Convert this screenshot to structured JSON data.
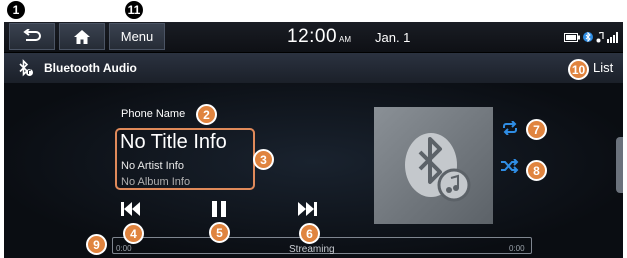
{
  "statusbar": {
    "menu_label": "Menu",
    "time": "12:00",
    "ampm": "AM",
    "date": "Jan. 1",
    "icons": [
      "battery-icon",
      "bluetooth-status-icon",
      "music-status-icon",
      "signal-icon"
    ]
  },
  "titlebar": {
    "title": "Bluetooth Audio",
    "list_label": "List"
  },
  "player": {
    "phone_name": "Phone Name",
    "title": "No Title Info",
    "artist": "No Artist Info",
    "album": "No Album Info",
    "elapsed": "0:00",
    "duration": "0:00",
    "status": "Streaming",
    "progress_fraction": 0
  },
  "callouts": {
    "c1": "1",
    "c2": "2",
    "c3": "3",
    "c4": "4",
    "c5": "5",
    "c6": "6",
    "c7": "7",
    "c8": "8",
    "c9": "9",
    "c10": "10",
    "c11": "11"
  },
  "colors": {
    "accent_orange": "#e0843f",
    "repeat_blue": "#2f8de4",
    "background": "#000000"
  }
}
